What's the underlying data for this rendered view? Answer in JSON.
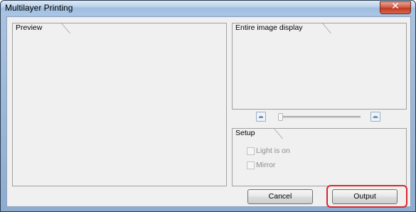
{
  "window": {
    "title": "Multilayer Printing",
    "close_glyph": "✕"
  },
  "preview": {
    "label": "Preview"
  },
  "entire_image": {
    "label": "Entire image display"
  },
  "zoom": {
    "out_icon": "zoom-out-icon",
    "in_icon": "zoom-in-icon",
    "level": 0
  },
  "setup": {
    "label": "Setup",
    "light_is_on": {
      "label": "Light is on",
      "checked": false,
      "enabled": false
    },
    "mirror": {
      "label": "Mirror",
      "checked": false,
      "enabled": false
    }
  },
  "buttons": {
    "cancel": "Cancel",
    "output": "Output"
  },
  "colors": {
    "highlight": "#d9262c",
    "disabled_text": "#8d8d8d"
  }
}
